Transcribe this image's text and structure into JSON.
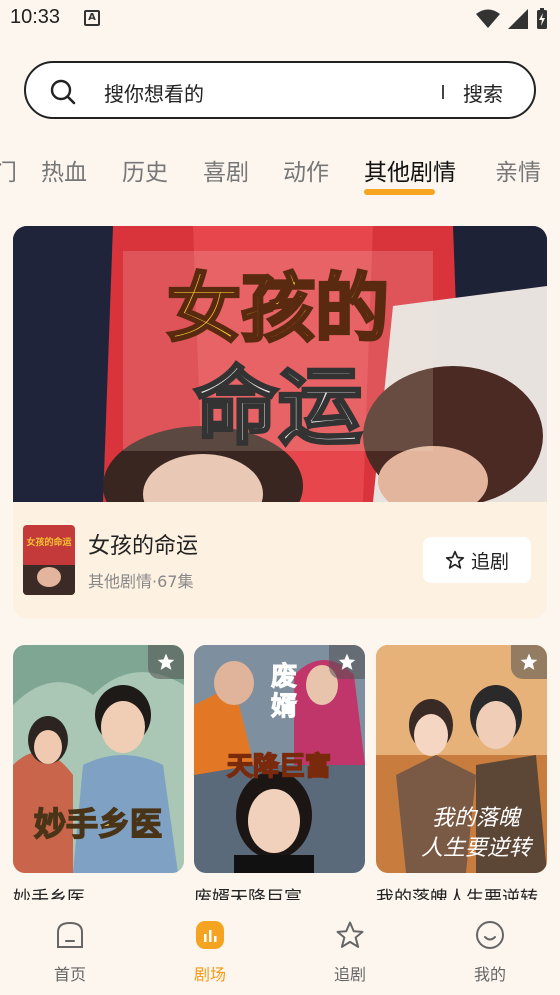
{
  "status_bar": {
    "time": "10:33",
    "notification_letter": "A"
  },
  "search": {
    "placeholder": "搜你想看的",
    "button_label": "搜索"
  },
  "tabs": [
    {
      "label": "门"
    },
    {
      "label": "热血"
    },
    {
      "label": "历史"
    },
    {
      "label": "喜剧"
    },
    {
      "label": "动作"
    },
    {
      "label": "其他剧情",
      "active": true
    },
    {
      "label": "亲情"
    }
  ],
  "featured": {
    "poster_text_line1": "女孩的",
    "poster_text_line2": "命运",
    "thumb_text": "女孩的命运",
    "title": "女孩的命运",
    "meta": "其他剧情·67集",
    "follow_label": "追剧"
  },
  "grid": [
    {
      "title": "妙手乡医",
      "poster_text": "妙手乡医"
    },
    {
      "title": "废婿天降巨富",
      "poster_text_line1": "废",
      "poster_text_line2": "婿",
      "poster_text_line3": "天降巨富"
    },
    {
      "title": "我的落魄人生要逆转",
      "poster_text_line1": "我的落魄",
      "poster_text_line2": "人生要逆转"
    }
  ],
  "bottom_nav": [
    {
      "label": "首页",
      "icon": "home-icon"
    },
    {
      "label": "剧场",
      "icon": "theater-icon",
      "active": true
    },
    {
      "label": "追剧",
      "icon": "star-icon"
    },
    {
      "label": "我的",
      "icon": "profile-icon"
    }
  ],
  "colors": {
    "accent": "#f5a422",
    "background": "#fdf6ef",
    "card": "#fdf1e2"
  }
}
